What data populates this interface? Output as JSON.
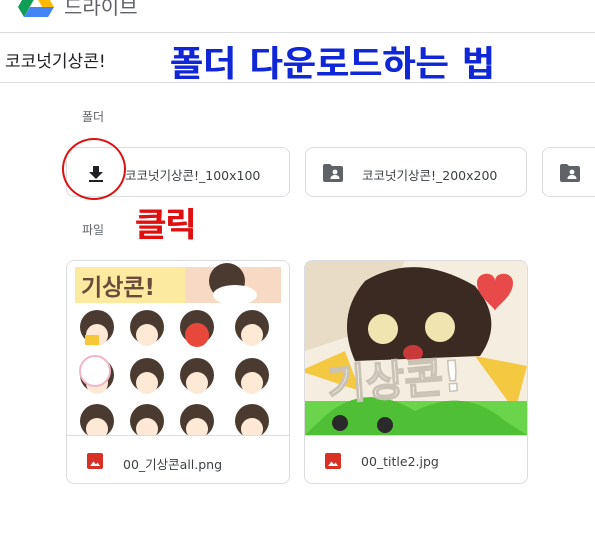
{
  "app": {
    "name": "드라이브"
  },
  "header": {
    "folder_title": "코코넛기상콘!",
    "overlay_title": "폴더 다운로드하는 법"
  },
  "sections": {
    "folders": "폴더",
    "files": "파일"
  },
  "folders": [
    {
      "name": "코코넛기상콘!_100x100",
      "icon": "download-icon"
    },
    {
      "name": "코코넛기상콘!_200x200",
      "icon": "shared-folder-icon"
    },
    {
      "name": "",
      "icon": "shared-folder-icon"
    }
  ],
  "annotation": {
    "click_label": "클릭"
  },
  "files": [
    {
      "name": "00_기상콘all.png",
      "icon": "image-icon",
      "thumb_text": "기상콘!"
    },
    {
      "name": "00_title2.jpg",
      "icon": "image-icon",
      "thumb_text": "기상콘!"
    }
  ],
  "colors": {
    "accent_red": "#e01010",
    "overlay_blue": "#1027d8",
    "image_icon": "#d93025",
    "border": "#dadce0"
  }
}
